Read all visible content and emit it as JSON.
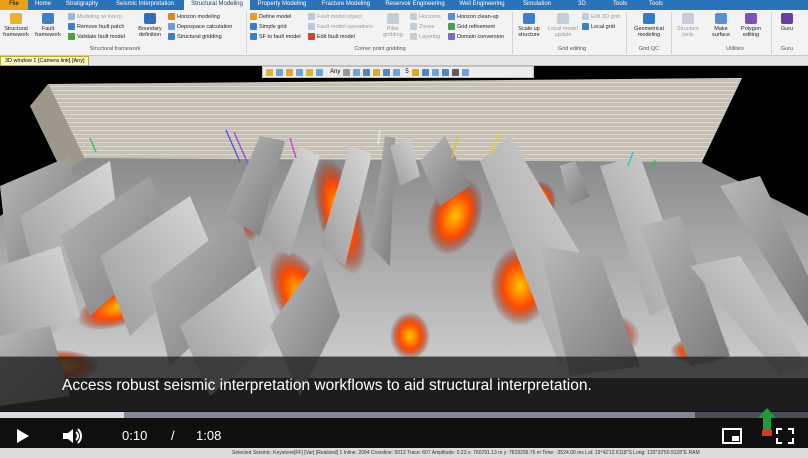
{
  "ribbon": {
    "tabs": [
      "File",
      "Home",
      "Stratigraphy",
      "Seismic Interpretation",
      "Structural Modeling",
      "Property Modeling",
      "Fracture Modeling",
      "Reservoir Engineering",
      "Well Engineering",
      "Simulation",
      "3D",
      "Tools",
      "Tools"
    ],
    "active_tab": "Structural Modeling",
    "structural_framework": {
      "structural_framework": "Structural framework",
      "fault_framework": "Fault framework",
      "modeling_w_interp": "Modeling w/ interp.",
      "remove_fault_patch": "Remove fault patch",
      "validate_fault_model": "Validate fault model",
      "boundary_definition": "Boundary definition",
      "horizon_modeling": "Horizon modeling",
      "depospace_calculation": "Depospace calculation",
      "structural_gridding": "Structural gridding",
      "group": "Structural framework"
    },
    "corner_point": {
      "define_model": "Define model",
      "simple_grid": "Simple grid",
      "sf_to_fault_model": "SF to fault model",
      "fault_model_object": "Fault model object",
      "fault_model_operations": "Fault model operations",
      "edit_fault_model": "Edit fault model",
      "pillar_gridding": "Pillar gridding",
      "horizons": "Horizons",
      "zones": "Zones",
      "layering": "Layering",
      "horizon_cleanup": "Horizon clean-up",
      "grid_refinement": "Grid refinement",
      "domain_conversion": "Domain conversion",
      "group": "Corner point gridding"
    },
    "grid_editing": {
      "scale_up_structure": "Scale up structure",
      "local_model_update": "Local model update",
      "edit_3d_grid": "Edit 3D grid",
      "local_grid": "Local grid",
      "group": "Grid editing"
    },
    "grid_qc": {
      "geometrical_modeling": "Geometrical modeling",
      "group": "Grid QC"
    },
    "structure_tools": {
      "label": "Structure tools",
      "group": "Utilities"
    },
    "make_surface": "Make surface",
    "polygon_editing": "Polygon editing",
    "guru": "Guru",
    "guru_group": "Guru"
  },
  "window_tab": "3D window 1 [Camera link] [Any]",
  "toolbar": {
    "filter": "Any",
    "level": "5"
  },
  "video": {
    "caption": "Access robust seismic interpretation workflows to aid structural interpretation.",
    "current_time": "0:10",
    "separator": "/",
    "duration": "1:08",
    "progress_fraction": 0.153,
    "buffered_fraction": 0.86
  },
  "status_bar": "Selected Seismic: Keystone[FF] [Var] [Realized] 1   Inline: 2094   Crossline: 5013   Trace: 607   Amplitude: 0.23   x: 760791.13 m   y: 7819299.76 m   Time: -3524.00 ms   Lat: 19°42'12.6118\"S   Long: 133°33'50.9128\"E   RAM",
  "colors": {
    "accent": "#2b73b9",
    "file_tab": "#e8a21a",
    "hot": "#ff4a00"
  },
  "icons": [
    "play-icon",
    "volume-icon",
    "subtitles-icon",
    "fullscreen-icon",
    "channel-logo-icon"
  ]
}
